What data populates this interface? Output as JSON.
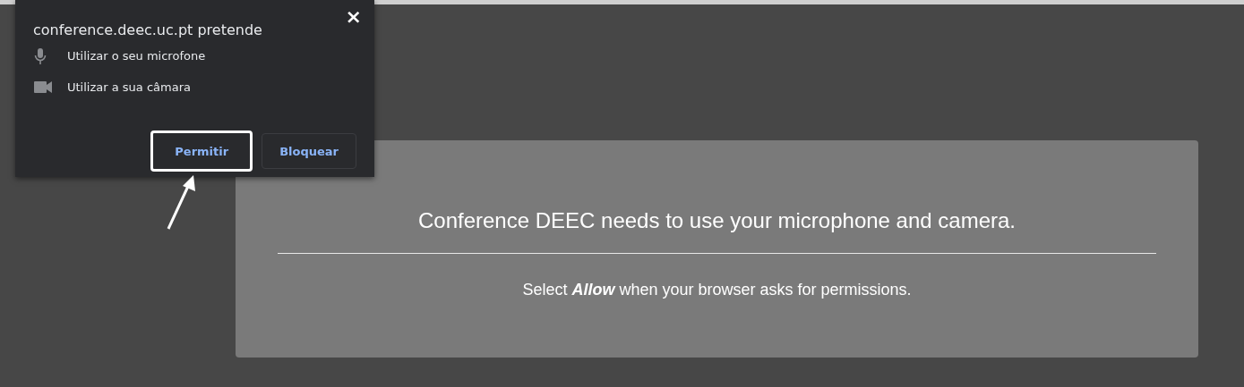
{
  "permission_popup": {
    "origin": "conference.deec.uc.pt pretende",
    "permissions": [
      {
        "kind": "microphone",
        "label": "Utilizar o seu microfone"
      },
      {
        "kind": "camera",
        "label": "Utilizar a sua câmara"
      }
    ],
    "buttons": [
      {
        "label": "Permitir",
        "highlighted": true
      },
      {
        "label": "Bloquear",
        "highlighted": false
      }
    ],
    "close": "×"
  },
  "notice": {
    "title": "Conference DEEC needs to use your microphone and camera.",
    "instruction": "Select **Allow** when your browser asks for permissions."
  }
}
